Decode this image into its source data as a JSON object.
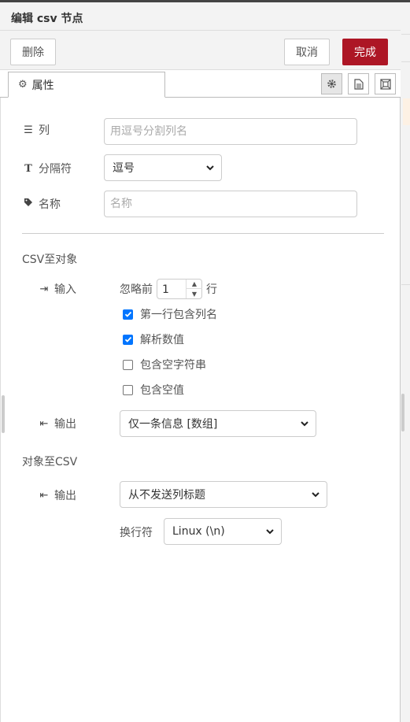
{
  "header": {
    "title": "编辑 csv 节点"
  },
  "toolbar": {
    "delete_label": "删除",
    "cancel_label": "取消",
    "done_label": "完成"
  },
  "tabs": {
    "properties_label": "属性",
    "icons": [
      "gear-icon",
      "description-icon",
      "appearance-icon"
    ]
  },
  "form": {
    "columns": {
      "label": "列",
      "placeholder": "用逗号分割列名",
      "value": ""
    },
    "separator": {
      "label": "分隔符",
      "value": "逗号"
    },
    "name": {
      "label": "名称",
      "placeholder": "名称",
      "value": ""
    }
  },
  "csv_to_object": {
    "title": "CSV至对象",
    "input_label": "输入",
    "skip_prefix": "忽略前",
    "skip_value": "1",
    "skip_suffix": "行",
    "options": [
      {
        "label": "第一行包含列名",
        "checked": true
      },
      {
        "label": "解析数值",
        "checked": true
      },
      {
        "label": "包含空字符串",
        "checked": false
      },
      {
        "label": "包含空值",
        "checked": false
      }
    ],
    "output_label": "输出",
    "output_value": "仅一条信息 [数组]"
  },
  "object_to_csv": {
    "title": "对象至CSV",
    "output_label": "输出",
    "output_value": "从不发送列标题",
    "newline_label": "换行符",
    "newline_value": "Linux (\\n)"
  },
  "colors": {
    "primary": "#ad1625",
    "checkbox": "#0075ff"
  }
}
